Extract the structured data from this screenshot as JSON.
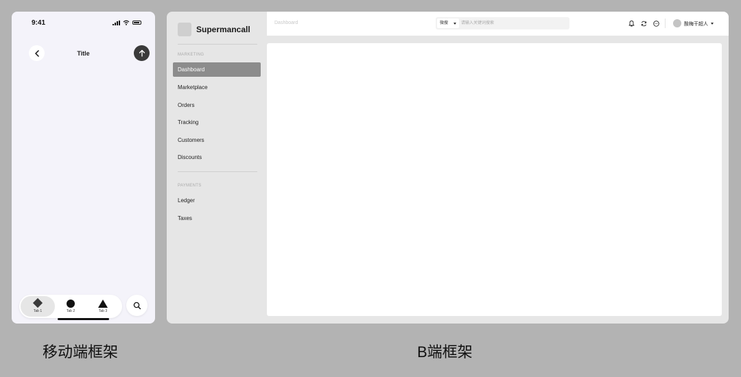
{
  "mobile": {
    "status_time": "9:41",
    "title": "Title",
    "tabs": [
      {
        "label": "Tab 1",
        "icon": "diamond-icon",
        "active": true
      },
      {
        "label": "Tab 2",
        "icon": "circle-icon",
        "active": false
      },
      {
        "label": "Tab 3",
        "icon": "triangle-icon",
        "active": false
      }
    ]
  },
  "desktop": {
    "brand": "Supermancall",
    "sections": [
      {
        "title": "MARKETING",
        "items": [
          "Dashboard",
          "Marketplace",
          "Orders",
          "Tracking",
          "Customers",
          "Discounts"
        ]
      },
      {
        "title": "PAYMENTS",
        "items": [
          "Ledger",
          "Taxes"
        ]
      }
    ],
    "active_item": "Dashboard",
    "breadcrumb": "Dashboard",
    "search": {
      "scope": "微搜",
      "placeholder": "请输入关键词搜索"
    },
    "user": {
      "name": "酸梅干超人"
    }
  },
  "captions": {
    "mobile": "移动端框架",
    "desktop": "B端框架"
  },
  "colors": {
    "background": "#b3b3b3",
    "active_nav": "#8c8c8c",
    "dark_button": "#3a3a3a"
  }
}
